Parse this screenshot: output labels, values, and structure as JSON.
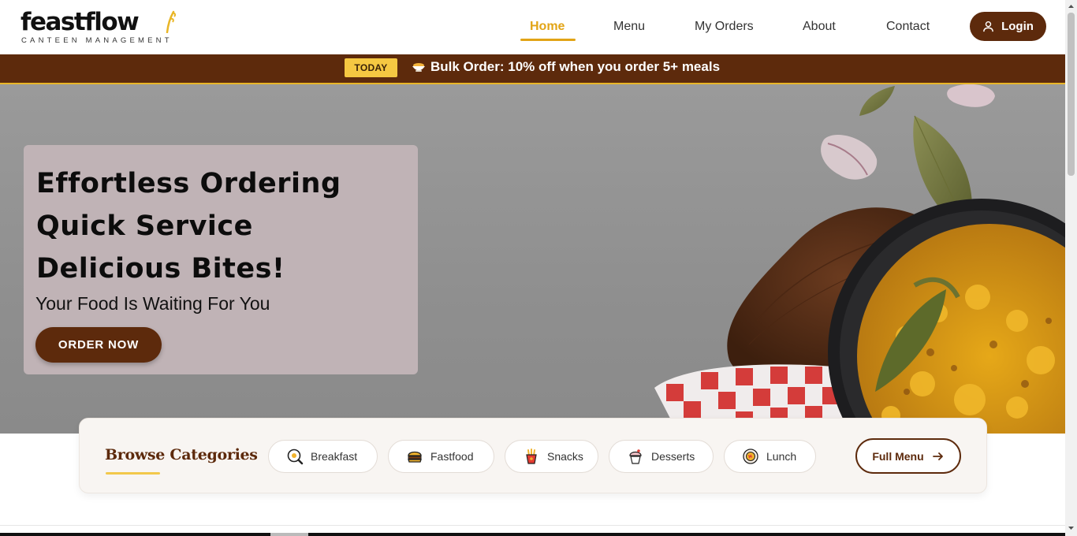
{
  "brand": {
    "name": "feastflow",
    "tagline": "CANTEEN MANAGEMENT"
  },
  "nav": {
    "items": [
      {
        "label": "Home",
        "active": true
      },
      {
        "label": "Menu"
      },
      {
        "label": "My Orders"
      },
      {
        "label": "About"
      },
      {
        "label": "Contact"
      }
    ],
    "login_label": "Login"
  },
  "promo": {
    "badge": "TODAY",
    "text": "Bulk Order: 10% off when you order 5+ meals",
    "icon": "bowl-icon"
  },
  "hero": {
    "title_lines": [
      "Effortless Ordering",
      "Quick Service",
      "Delicious Bites!"
    ],
    "subtitle": "Your Food Is Waiting For You",
    "cta_label": "ORDER NOW"
  },
  "categories": {
    "title": "Browse Categories",
    "items": [
      {
        "label": "Breakfast",
        "icon": "frying-pan-icon"
      },
      {
        "label": "Fastfood",
        "icon": "burger-icon"
      },
      {
        "label": "Snacks",
        "icon": "fries-icon"
      },
      {
        "label": "Desserts",
        "icon": "cupcake-icon"
      },
      {
        "label": "Lunch",
        "icon": "plate-icon"
      }
    ],
    "full_menu_label": "Full Menu"
  },
  "colors": {
    "brand_brown": "#5d2a0c",
    "accent_gold": "#e2a416",
    "badge_yellow": "#f5c842"
  }
}
